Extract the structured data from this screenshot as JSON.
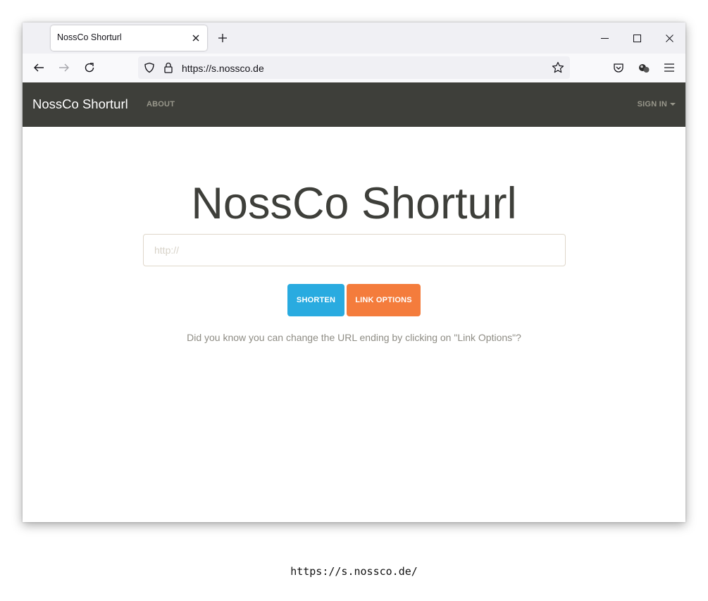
{
  "browser": {
    "tab_title": "NossCo Shorturl",
    "url": "https://s.nossco.de"
  },
  "site": {
    "brand": "NossCo Shorturl",
    "nav_about": "ABOUT",
    "nav_signin": "SIGN IN"
  },
  "main": {
    "title": "NossCo Shorturl",
    "input_placeholder": "http://",
    "shorten_label": "SHORTEN",
    "link_options_label": "LINK OPTIONS",
    "hint": "Did you know you can change the URL ending by clicking on \"Link Options\"?"
  },
  "caption": "https://s.nossco.de/",
  "colors": {
    "navbar_bg": "#3e3f3a",
    "shorten_button": "#29abe0",
    "link_options_button": "#f47c3c",
    "title_text": "#3e3f3a"
  },
  "icons": [
    "close-icon",
    "plus-icon",
    "minimize-icon",
    "maximize-icon",
    "back-arrow-icon",
    "forward-arrow-icon",
    "reload-icon",
    "shield-icon",
    "lock-icon",
    "star-icon",
    "pocket-icon",
    "extensions-icon",
    "menu-icon",
    "caret-down-icon"
  ]
}
